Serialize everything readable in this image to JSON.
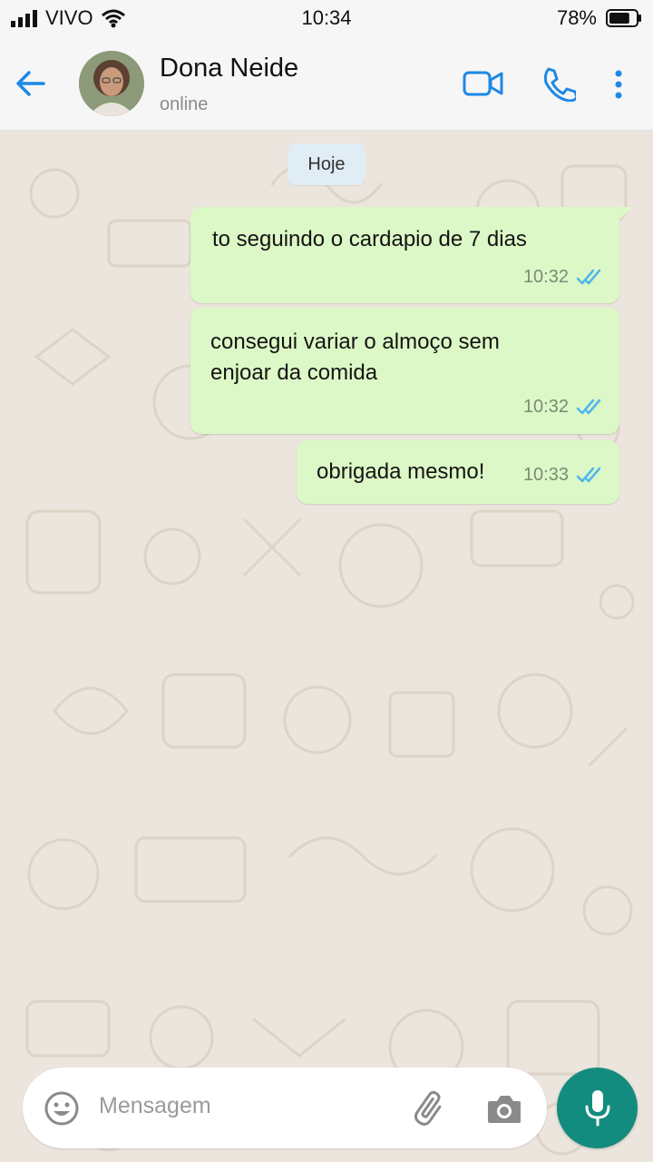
{
  "status_bar": {
    "carrier": "VIVO",
    "time": "10:34",
    "battery": "78%",
    "battery_level": 0.78
  },
  "header": {
    "contact_name": "Dona Neide",
    "presence": "online",
    "icons": [
      "back-arrow-icon",
      "video-call-icon",
      "phone-icon",
      "more-options-icon"
    ]
  },
  "chat": {
    "date_label": "Hoje",
    "messages": [
      {
        "text": "to seguindo o cardapio de 7 dias",
        "time": "10:32",
        "status": "read"
      },
      {
        "text": "consegui variar o almoço sem\nenjoar da comida",
        "time": "10:32",
        "status": "read"
      },
      {
        "text": "obrigada mesmo!",
        "time": "10:33",
        "status": "read"
      }
    ]
  },
  "composer": {
    "placeholder": "Mensagem",
    "icons": [
      "emoji-icon",
      "attach-icon",
      "camera-icon",
      "microphone-icon"
    ]
  },
  "colors": {
    "accent_blue": "#1e88e5",
    "bubble_out": "#dcf8c6",
    "read_ticks": "#4fb6ec",
    "mic_button": "#128c7e",
    "wallpaper": "#ece5dd"
  }
}
